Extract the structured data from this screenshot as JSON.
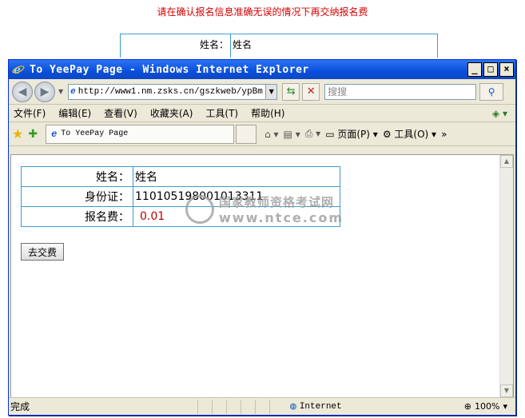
{
  "notice": "请在确认报名信息准确无误的情况下再交纳报名费",
  "background_table": {
    "name_label": "姓名：",
    "name_value": "姓名"
  },
  "window": {
    "title": "To YeePay Page - Windows Internet Explorer",
    "controls": {
      "minimize": "_",
      "maximize": "□",
      "close": "×"
    }
  },
  "address_bar": {
    "url": "http://www1.nm.zsks.cn/gszkweb/ypBm",
    "search_placeholder": "搜搜"
  },
  "menu": [
    "文件(F)",
    "编辑(E)",
    "查看(V)",
    "收藏夹(A)",
    "工具(T)",
    "帮助(H)"
  ],
  "tab": {
    "title": "To YeePay Page"
  },
  "commands": {
    "page": "页面(P)",
    "tools": "工具(O)"
  },
  "form": {
    "rows": [
      {
        "label": "姓名：",
        "value": "姓名"
      },
      {
        "label": "身份证：",
        "value": "110105198001013311"
      },
      {
        "label": "报名费：",
        "value": "0.01"
      }
    ],
    "pay_button": "去交费"
  },
  "watermark": {
    "name": "国家教师资格考试网",
    "url": "www.ntce.com"
  },
  "status": {
    "text": "完成",
    "zone": "Internet",
    "zoom": "100%"
  }
}
